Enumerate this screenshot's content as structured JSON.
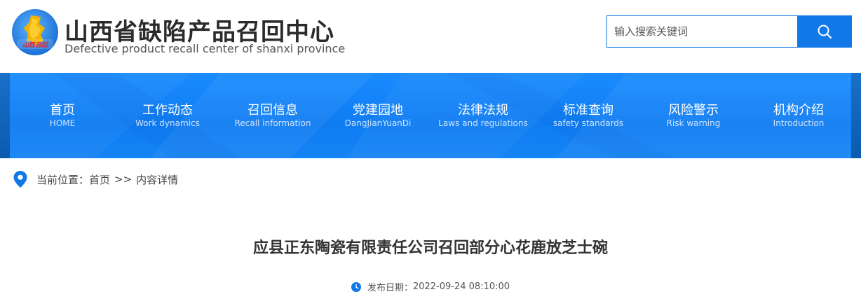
{
  "header": {
    "logo_text": "山西召回",
    "title": "山西省缺陷产品召回中心",
    "subtitle": "Defective product recall center of shanxi province",
    "search": {
      "placeholder": "输入搜索关键词",
      "value": ""
    }
  },
  "nav": {
    "items": [
      {
        "zh": "首页",
        "en": "HOME"
      },
      {
        "zh": "工作动态",
        "en": "Work dynamics"
      },
      {
        "zh": "召回信息",
        "en": "Recall information"
      },
      {
        "zh": "党建园地",
        "en": "DangJianYuanDi"
      },
      {
        "zh": "法律法规",
        "en": "Laws and regulations"
      },
      {
        "zh": "标准查询",
        "en": "safety standards"
      },
      {
        "zh": "风险警示",
        "en": "Risk warning"
      },
      {
        "zh": "机构介绍",
        "en": "Introduction"
      }
    ]
  },
  "breadcrumb": {
    "label": "当前位置：",
    "home": "首页",
    "separator": ">>",
    "current": "内容详情"
  },
  "article": {
    "title": "应县正东陶瓷有限责任公司召回部分心花鹿放芝士碗",
    "publish_label": "发布日期：",
    "publish_date": "2022-09-24 08:10:00"
  },
  "colors": {
    "brand_blue": "#1178e8",
    "nav_blue": "#0f7cf2",
    "title_text": "#333333"
  },
  "icons": {
    "search": "search-icon",
    "location": "location-pin-icon",
    "clock": "clock-icon"
  }
}
